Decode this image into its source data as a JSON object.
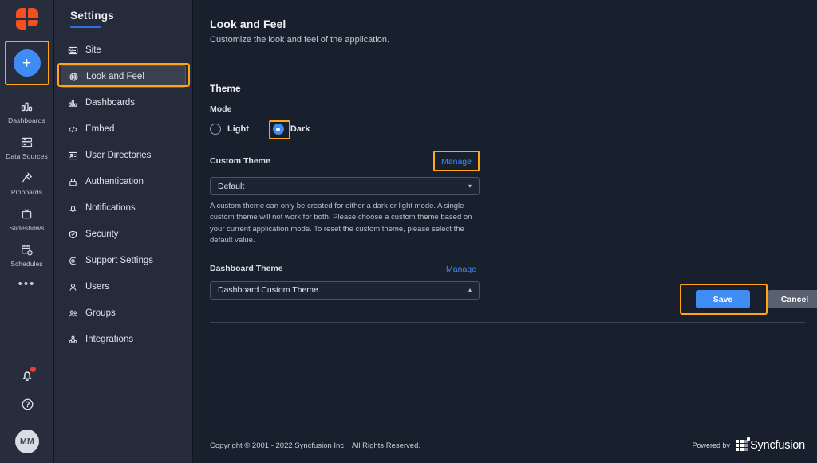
{
  "rail": {
    "logo_name": "syncfusion-app-logo",
    "add_button": {
      "label": "+",
      "name": "create-new-button"
    },
    "items": [
      {
        "label": "Dashboards",
        "icon": "bar-chart-icon"
      },
      {
        "label": "Data Sources",
        "icon": "database-icon"
      },
      {
        "label": "Pinboards",
        "icon": "pin-icon"
      },
      {
        "label": "Slideshows",
        "icon": "tv-icon"
      },
      {
        "label": "Schedules",
        "icon": "calendar-clock-icon"
      }
    ],
    "more_label": "•••",
    "notifications_icon": "bell-icon",
    "help_icon": "help-circle-icon",
    "avatar_initials": "MM"
  },
  "sidebar": {
    "title": "Settings",
    "items": [
      {
        "label": "Site",
        "icon": "site-icon",
        "active": false
      },
      {
        "label": "Look and Feel",
        "icon": "globe-icon",
        "active": true
      },
      {
        "label": "Dashboards",
        "icon": "bar-chart-icon",
        "active": false
      },
      {
        "label": "Embed",
        "icon": "code-icon",
        "active": false
      },
      {
        "label": "User Directories",
        "icon": "id-card-icon",
        "active": false
      },
      {
        "label": "Authentication",
        "icon": "lock-icon",
        "active": false
      },
      {
        "label": "Notifications",
        "icon": "bell-icon",
        "active": false
      },
      {
        "label": "Security",
        "icon": "shield-icon",
        "active": false
      },
      {
        "label": "Support Settings",
        "icon": "lifebuoy-icon",
        "active": false
      },
      {
        "label": "Users",
        "icon": "user-icon",
        "active": false
      },
      {
        "label": "Groups",
        "icon": "users-icon",
        "active": false
      },
      {
        "label": "Integrations",
        "icon": "integrations-icon",
        "active": false
      }
    ]
  },
  "header": {
    "title": "Look and Feel",
    "subtitle": "Customize the look and feel of the application."
  },
  "theme": {
    "section_title": "Theme",
    "mode_label": "Mode",
    "mode_options": [
      {
        "label": "Light",
        "selected": false
      },
      {
        "label": "Dark",
        "selected": true
      }
    ],
    "custom_theme_label": "Custom Theme",
    "custom_theme_manage": "Manage",
    "custom_theme_value": "Default",
    "custom_theme_caret": "▾",
    "helper_text": "A custom theme can only be created for either a dark or light mode. A single custom theme will not work for both. Please choose a custom theme based on your current application mode. To reset the custom theme, please select the default value.",
    "dashboard_theme_label": "Dashboard Theme",
    "dashboard_theme_manage": "Manage",
    "dashboard_theme_value": "Dashboard Custom Theme",
    "dashboard_theme_caret": "▴"
  },
  "actions": {
    "save_label": "Save",
    "cancel_label": "Cancel"
  },
  "footer": {
    "copyright": "Copyright © 2001 - 2022 Syncfusion Inc. | All Rights Reserved.",
    "powered_by": "Powered by",
    "brand": "Syncfusion"
  },
  "colors": {
    "accent_blue": "#3f8cf5",
    "highlight_orange": "#ffa516",
    "brand_orange": "#f4501e",
    "notification_red": "#ef3b2d"
  }
}
